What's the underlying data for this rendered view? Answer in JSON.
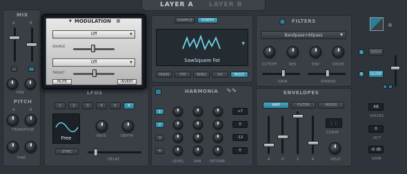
{
  "tabs": {
    "layer_a": "LAYER A",
    "layer_b": "LAYER B"
  },
  "mix": {
    "title": "MIX",
    "a": "A",
    "b": "B",
    "pan": "PAN"
  },
  "pitch": {
    "title": "PITCH",
    "a": "A",
    "b": "B",
    "transpose": "TRANSPOSE",
    "fine": "FINE"
  },
  "modulation": {
    "title": "MODULATION",
    "source_value": "Off",
    "source_label": "SOURCE",
    "target_value": "Off",
    "target_label": "TARGET",
    "mute": "MUTE",
    "invert": "INVERT"
  },
  "osc": {
    "sample": "SAMPLE",
    "synth": "SYNTH",
    "wave_name": "SawSquare Fat",
    "modes": [
      "MAIN",
      "FM",
      "RING",
      "VS",
      "MULT"
    ],
    "active_mode": "MULT"
  },
  "lfos": {
    "title": "LFOS",
    "tabs": [
      "1",
      "2",
      "3",
      "4",
      "5",
      "6"
    ],
    "active_tab": "6",
    "wave_label": "Free",
    "sync": "SYNC",
    "rate": "RATE",
    "depth": "DEPTH",
    "delay": "DELAY"
  },
  "harmonia": {
    "title": "HARMONIA",
    "voices": [
      "1",
      "2",
      "3",
      "4"
    ],
    "values": [
      "+7",
      "0",
      "-12",
      "0"
    ],
    "level": "LEVEL",
    "pan": "PAN",
    "detune": "DETUNE"
  },
  "filters": {
    "title": "FILTERS",
    "type": "Bandpass+Allpass",
    "cutoff": "CUTOFF",
    "res": "RES",
    "env": "ENV",
    "drive": "DRIVE",
    "gain": "GAIN",
    "spread": "SPREAD"
  },
  "envelopes": {
    "title": "ENVELOPES",
    "amp": "AMP",
    "filter": "FILTER",
    "mods": "MODS",
    "a": "A",
    "d": "D",
    "s": "S",
    "r": "R",
    "velo": "VELO",
    "curve": "CURVE"
  },
  "right": {
    "solo": "SOLO",
    "glide": "GLIDE",
    "voices_value": "48",
    "voices": "VOICES",
    "oct_value": "0",
    "oct": "OCT",
    "gain_value": "-6 db",
    "gain": "GAIN",
    "l": "L",
    "r": "R"
  },
  "accent": "#2a7f98"
}
